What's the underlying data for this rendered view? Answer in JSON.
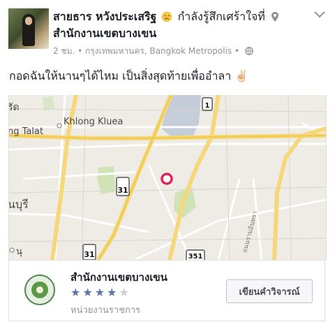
{
  "post": {
    "author_name": "สายธาร หวังประเสริฐ",
    "feeling_text": "กำลังรู้สึกเศร้าใจที่",
    "location_name": "สำนักงานเขตบางเขน",
    "time": "2 ชม.",
    "separator": "•",
    "location_line": "กรุงเทพมหานคร, Bangkok Metropolis",
    "separator2": "•",
    "body_text": "กอดฉันให้นานๆได้ไหม เป็นสิ่งสุดท้ายเพื่ออำลา",
    "body_emoji": "✌🏻",
    "feeling_icon": "sad-face-icon",
    "privacy_icon": "globe-icon"
  },
  "map": {
    "labels": {
      "rd": "รัด",
      "khlong_kluea": "Khlong Kluea",
      "ng_talat": "ng Talat",
      "nburi": "นบุรี",
      "nu": "นุ"
    },
    "road_badges": [
      "1",
      "31",
      "31",
      "351"
    ],
    "accent": "#e0245e"
  },
  "place": {
    "name": "สำนักงานเขตบางเขน",
    "rating_stars": 4,
    "rating_max": 5,
    "star_glyph": "★",
    "category": "หน่วยงานราชการ",
    "review_button": "เขียนคำวิจารณ์"
  },
  "colors": {
    "star_on": "#5b74a8",
    "star_off": "#c9ccd1",
    "meta_gray": "#90949c"
  }
}
